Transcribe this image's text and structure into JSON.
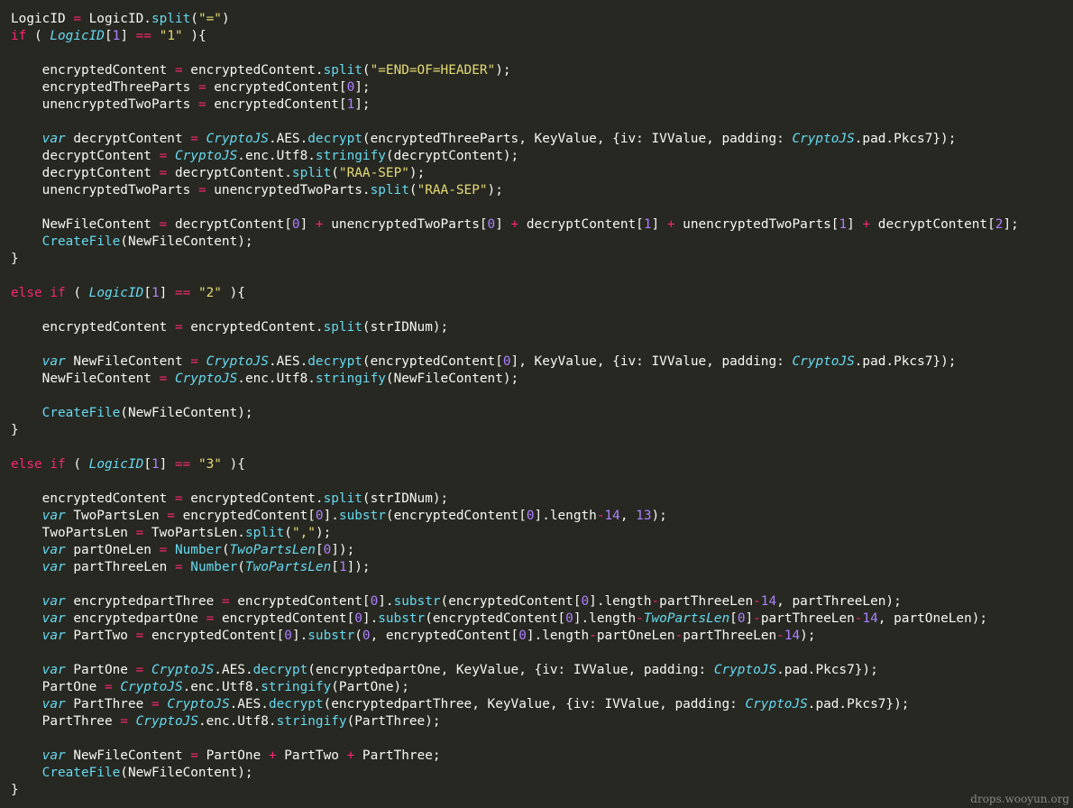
{
  "colors": {
    "background": "#272822",
    "plain": "#f8f8f2",
    "keyword": "#f92672",
    "string": "#e6db74",
    "number": "#ae81ff",
    "function": "#66d9ef"
  },
  "watermark": "drops.wooyun.org",
  "code_lines": [
    [
      [
        "p",
        "LogicID "
      ],
      [
        "o",
        "="
      ],
      [
        "p",
        " LogicID."
      ],
      [
        "f",
        "split"
      ],
      [
        "p",
        "("
      ],
      [
        "s",
        "\"=\""
      ],
      [
        "p",
        ")"
      ]
    ],
    [
      [
        "k",
        "if"
      ],
      [
        "p",
        " ( "
      ],
      [
        "i",
        "LogicID"
      ],
      [
        "p",
        "["
      ],
      [
        "n",
        "1"
      ],
      [
        "p",
        "] "
      ],
      [
        "o",
        "=="
      ],
      [
        "p",
        " "
      ],
      [
        "s",
        "\"1\""
      ],
      [
        "p",
        " ){"
      ]
    ],
    [],
    [
      [
        "p",
        "    encryptedContent "
      ],
      [
        "o",
        "="
      ],
      [
        "p",
        " encryptedContent."
      ],
      [
        "f",
        "split"
      ],
      [
        "p",
        "("
      ],
      [
        "s",
        "\"=END=OF=HEADER\""
      ],
      [
        "p",
        ");"
      ]
    ],
    [
      [
        "p",
        "    encryptedThreeParts "
      ],
      [
        "o",
        "="
      ],
      [
        "p",
        " encryptedContent["
      ],
      [
        "n",
        "0"
      ],
      [
        "p",
        "];"
      ]
    ],
    [
      [
        "p",
        "    unencryptedTwoParts "
      ],
      [
        "o",
        "="
      ],
      [
        "p",
        " encryptedContent["
      ],
      [
        "n",
        "1"
      ],
      [
        "p",
        "];"
      ]
    ],
    [],
    [
      [
        "p",
        "    "
      ],
      [
        "v",
        "var"
      ],
      [
        "p",
        " decryptContent "
      ],
      [
        "o",
        "="
      ],
      [
        "p",
        " "
      ],
      [
        "i",
        "CryptoJS"
      ],
      [
        "p",
        ".AES."
      ],
      [
        "f",
        "decrypt"
      ],
      [
        "p",
        "(encryptedThreeParts, KeyValue, {iv: IVValue, padding: "
      ],
      [
        "i",
        "CryptoJS"
      ],
      [
        "p",
        ".pad.Pkcs7});"
      ]
    ],
    [
      [
        "p",
        "    decryptContent "
      ],
      [
        "o",
        "="
      ],
      [
        "p",
        " "
      ],
      [
        "i",
        "CryptoJS"
      ],
      [
        "p",
        ".enc.Utf8."
      ],
      [
        "f",
        "stringify"
      ],
      [
        "p",
        "(decryptContent);"
      ]
    ],
    [
      [
        "p",
        "    decryptContent "
      ],
      [
        "o",
        "="
      ],
      [
        "p",
        " decryptContent."
      ],
      [
        "f",
        "split"
      ],
      [
        "p",
        "("
      ],
      [
        "s",
        "\"RAA-SEP\""
      ],
      [
        "p",
        ");"
      ]
    ],
    [
      [
        "p",
        "    unencryptedTwoParts "
      ],
      [
        "o",
        "="
      ],
      [
        "p",
        " unencryptedTwoParts."
      ],
      [
        "f",
        "split"
      ],
      [
        "p",
        "("
      ],
      [
        "s",
        "\"RAA-SEP\""
      ],
      [
        "p",
        ");"
      ]
    ],
    [],
    [
      [
        "p",
        "    NewFileContent "
      ],
      [
        "o",
        "="
      ],
      [
        "p",
        " decryptContent["
      ],
      [
        "n",
        "0"
      ],
      [
        "p",
        "] "
      ],
      [
        "o",
        "+"
      ],
      [
        "p",
        " unencryptedTwoParts["
      ],
      [
        "n",
        "0"
      ],
      [
        "p",
        "] "
      ],
      [
        "o",
        "+"
      ],
      [
        "p",
        " decryptContent["
      ],
      [
        "n",
        "1"
      ],
      [
        "p",
        "] "
      ],
      [
        "o",
        "+"
      ],
      [
        "p",
        " unencryptedTwoParts["
      ],
      [
        "n",
        "1"
      ],
      [
        "p",
        "] "
      ],
      [
        "o",
        "+"
      ],
      [
        "p",
        " decryptContent["
      ],
      [
        "n",
        "2"
      ],
      [
        "p",
        "];"
      ]
    ],
    [
      [
        "p",
        "    "
      ],
      [
        "f",
        "CreateFile"
      ],
      [
        "p",
        "(NewFileContent);"
      ]
    ],
    [
      [
        "p",
        "}"
      ]
    ],
    [],
    [
      [
        "k",
        "else if"
      ],
      [
        "p",
        " ( "
      ],
      [
        "i",
        "LogicID"
      ],
      [
        "p",
        "["
      ],
      [
        "n",
        "1"
      ],
      [
        "p",
        "] "
      ],
      [
        "o",
        "=="
      ],
      [
        "p",
        " "
      ],
      [
        "s",
        "\"2\""
      ],
      [
        "p",
        " ){"
      ]
    ],
    [],
    [
      [
        "p",
        "    encryptedContent "
      ],
      [
        "o",
        "="
      ],
      [
        "p",
        " encryptedContent."
      ],
      [
        "f",
        "split"
      ],
      [
        "p",
        "(strIDNum);"
      ]
    ],
    [],
    [
      [
        "p",
        "    "
      ],
      [
        "v",
        "var"
      ],
      [
        "p",
        " NewFileContent "
      ],
      [
        "o",
        "="
      ],
      [
        "p",
        " "
      ],
      [
        "i",
        "CryptoJS"
      ],
      [
        "p",
        ".AES."
      ],
      [
        "f",
        "decrypt"
      ],
      [
        "p",
        "(encryptedContent["
      ],
      [
        "n",
        "0"
      ],
      [
        "p",
        "], KeyValue, {iv: IVValue, padding: "
      ],
      [
        "i",
        "CryptoJS"
      ],
      [
        "p",
        ".pad.Pkcs7});"
      ]
    ],
    [
      [
        "p",
        "    NewFileContent "
      ],
      [
        "o",
        "="
      ],
      [
        "p",
        " "
      ],
      [
        "i",
        "CryptoJS"
      ],
      [
        "p",
        ".enc.Utf8."
      ],
      [
        "f",
        "stringify"
      ],
      [
        "p",
        "(NewFileContent);"
      ]
    ],
    [],
    [
      [
        "p",
        "    "
      ],
      [
        "f",
        "CreateFile"
      ],
      [
        "p",
        "(NewFileContent);"
      ]
    ],
    [
      [
        "p",
        "}"
      ]
    ],
    [],
    [
      [
        "k",
        "else if"
      ],
      [
        "p",
        " ( "
      ],
      [
        "i",
        "LogicID"
      ],
      [
        "p",
        "["
      ],
      [
        "n",
        "1"
      ],
      [
        "p",
        "] "
      ],
      [
        "o",
        "=="
      ],
      [
        "p",
        " "
      ],
      [
        "s",
        "\"3\""
      ],
      [
        "p",
        " ){"
      ]
    ],
    [],
    [
      [
        "p",
        "    encryptedContent "
      ],
      [
        "o",
        "="
      ],
      [
        "p",
        " encryptedContent."
      ],
      [
        "f",
        "split"
      ],
      [
        "p",
        "(strIDNum);"
      ]
    ],
    [
      [
        "p",
        "    "
      ],
      [
        "v",
        "var"
      ],
      [
        "p",
        " TwoPartsLen "
      ],
      [
        "o",
        "="
      ],
      [
        "p",
        " encryptedContent["
      ],
      [
        "n",
        "0"
      ],
      [
        "p",
        "]."
      ],
      [
        "f",
        "substr"
      ],
      [
        "p",
        "(encryptedContent["
      ],
      [
        "n",
        "0"
      ],
      [
        "p",
        "].length"
      ],
      [
        "o",
        "-"
      ],
      [
        "n",
        "14"
      ],
      [
        "p",
        ", "
      ],
      [
        "n",
        "13"
      ],
      [
        "p",
        ");"
      ]
    ],
    [
      [
        "p",
        "    TwoPartsLen "
      ],
      [
        "o",
        "="
      ],
      [
        "p",
        " TwoPartsLen."
      ],
      [
        "f",
        "split"
      ],
      [
        "p",
        "("
      ],
      [
        "s",
        "\",\""
      ],
      [
        "p",
        ");"
      ]
    ],
    [
      [
        "p",
        "    "
      ],
      [
        "v",
        "var"
      ],
      [
        "p",
        " partOneLen "
      ],
      [
        "o",
        "="
      ],
      [
        "p",
        " "
      ],
      [
        "f",
        "Number"
      ],
      [
        "p",
        "("
      ],
      [
        "i",
        "TwoPartsLen"
      ],
      [
        "p",
        "["
      ],
      [
        "n",
        "0"
      ],
      [
        "p",
        "]);"
      ]
    ],
    [
      [
        "p",
        "    "
      ],
      [
        "v",
        "var"
      ],
      [
        "p",
        " partThreeLen "
      ],
      [
        "o",
        "="
      ],
      [
        "p",
        " "
      ],
      [
        "f",
        "Number"
      ],
      [
        "p",
        "("
      ],
      [
        "i",
        "TwoPartsLen"
      ],
      [
        "p",
        "["
      ],
      [
        "n",
        "1"
      ],
      [
        "p",
        "]);"
      ]
    ],
    [],
    [
      [
        "p",
        "    "
      ],
      [
        "v",
        "var"
      ],
      [
        "p",
        " encryptedpartThree "
      ],
      [
        "o",
        "="
      ],
      [
        "p",
        " encryptedContent["
      ],
      [
        "n",
        "0"
      ],
      [
        "p",
        "]."
      ],
      [
        "f",
        "substr"
      ],
      [
        "p",
        "(encryptedContent["
      ],
      [
        "n",
        "0"
      ],
      [
        "p",
        "].length"
      ],
      [
        "o",
        "-"
      ],
      [
        "p",
        "partThreeLen"
      ],
      [
        "o",
        "-"
      ],
      [
        "n",
        "14"
      ],
      [
        "p",
        ", partThreeLen);"
      ]
    ],
    [
      [
        "p",
        "    "
      ],
      [
        "v",
        "var"
      ],
      [
        "p",
        " encryptedpartOne "
      ],
      [
        "o",
        "="
      ],
      [
        "p",
        " encryptedContent["
      ],
      [
        "n",
        "0"
      ],
      [
        "p",
        "]."
      ],
      [
        "f",
        "substr"
      ],
      [
        "p",
        "(encryptedContent["
      ],
      [
        "n",
        "0"
      ],
      [
        "p",
        "].length"
      ],
      [
        "o",
        "-"
      ],
      [
        "i",
        "TwoPartsLen"
      ],
      [
        "p",
        "["
      ],
      [
        "n",
        "0"
      ],
      [
        "p",
        "]"
      ],
      [
        "o",
        "-"
      ],
      [
        "p",
        "partThreeLen"
      ],
      [
        "o",
        "-"
      ],
      [
        "n",
        "14"
      ],
      [
        "p",
        ", partOneLen);"
      ]
    ],
    [
      [
        "p",
        "    "
      ],
      [
        "v",
        "var"
      ],
      [
        "p",
        " PartTwo "
      ],
      [
        "o",
        "="
      ],
      [
        "p",
        " encryptedContent["
      ],
      [
        "n",
        "0"
      ],
      [
        "p",
        "]."
      ],
      [
        "f",
        "substr"
      ],
      [
        "p",
        "("
      ],
      [
        "n",
        "0"
      ],
      [
        "p",
        ", encryptedContent["
      ],
      [
        "n",
        "0"
      ],
      [
        "p",
        "].length"
      ],
      [
        "o",
        "-"
      ],
      [
        "p",
        "partOneLen"
      ],
      [
        "o",
        "-"
      ],
      [
        "p",
        "partThreeLen"
      ],
      [
        "o",
        "-"
      ],
      [
        "n",
        "14"
      ],
      [
        "p",
        ");"
      ]
    ],
    [],
    [
      [
        "p",
        "    "
      ],
      [
        "v",
        "var"
      ],
      [
        "p",
        " PartOne "
      ],
      [
        "o",
        "="
      ],
      [
        "p",
        " "
      ],
      [
        "i",
        "CryptoJS"
      ],
      [
        "p",
        ".AES."
      ],
      [
        "f",
        "decrypt"
      ],
      [
        "p",
        "(encryptedpartOne, KeyValue, {iv: IVValue, padding: "
      ],
      [
        "i",
        "CryptoJS"
      ],
      [
        "p",
        ".pad.Pkcs7});"
      ]
    ],
    [
      [
        "p",
        "    PartOne "
      ],
      [
        "o",
        "="
      ],
      [
        "p",
        " "
      ],
      [
        "i",
        "CryptoJS"
      ],
      [
        "p",
        ".enc.Utf8."
      ],
      [
        "f",
        "stringify"
      ],
      [
        "p",
        "(PartOne);"
      ]
    ],
    [
      [
        "p",
        "    "
      ],
      [
        "v",
        "var"
      ],
      [
        "p",
        " PartThree "
      ],
      [
        "o",
        "="
      ],
      [
        "p",
        " "
      ],
      [
        "i",
        "CryptoJS"
      ],
      [
        "p",
        ".AES."
      ],
      [
        "f",
        "decrypt"
      ],
      [
        "p",
        "(encryptedpartThree, KeyValue, {iv: IVValue, padding: "
      ],
      [
        "i",
        "CryptoJS"
      ],
      [
        "p",
        ".pad.Pkcs7});"
      ]
    ],
    [
      [
        "p",
        "    PartThree "
      ],
      [
        "o",
        "="
      ],
      [
        "p",
        " "
      ],
      [
        "i",
        "CryptoJS"
      ],
      [
        "p",
        ".enc.Utf8."
      ],
      [
        "f",
        "stringify"
      ],
      [
        "p",
        "(PartThree);"
      ]
    ],
    [],
    [
      [
        "p",
        "    "
      ],
      [
        "v",
        "var"
      ],
      [
        "p",
        " NewFileContent "
      ],
      [
        "o",
        "="
      ],
      [
        "p",
        " PartOne "
      ],
      [
        "o",
        "+"
      ],
      [
        "p",
        " PartTwo "
      ],
      [
        "o",
        "+"
      ],
      [
        "p",
        " PartThree;"
      ]
    ],
    [
      [
        "p",
        "    "
      ],
      [
        "f",
        "CreateFile"
      ],
      [
        "p",
        "(NewFileContent);"
      ]
    ],
    [
      [
        "p",
        "}"
      ]
    ]
  ]
}
